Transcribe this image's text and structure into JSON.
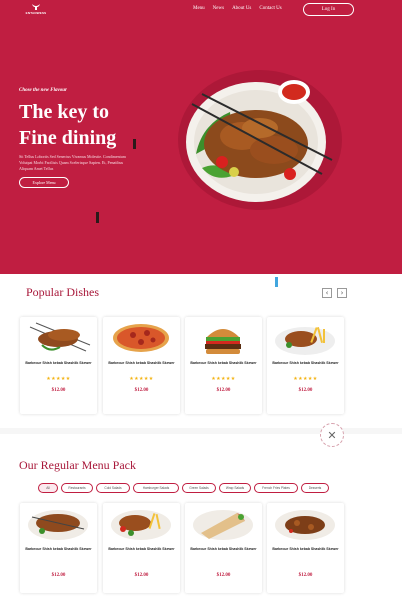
{
  "header": {
    "brand": "ENTANWESS",
    "nav": [
      "Menu",
      "News",
      "About Us",
      "Contact Us"
    ],
    "login_label": "Log In"
  },
  "hero": {
    "tagline": "Chose the new Flavour",
    "headline_line1": "The key to",
    "headline_line2": "Fine dining",
    "description": "Sit Tellus Lobortis Sed Senectus Vivamus Molestie. Condimentum Volutpat Morbi Facilisis Quam Scelerisque Sapien. Et, Penatibus Aliquam Amet Tellus",
    "explore_label": "Explore Menu"
  },
  "popular": {
    "title": "Popular Dishes",
    "prev_icon": "‹",
    "next_icon": "›",
    "cards": [
      {
        "image": "kebab-skewers",
        "title": "Barbecue Shish kebab Shashlik Skewer",
        "stars": "★★★★★",
        "price": "$12.00"
      },
      {
        "image": "pizza",
        "title": "Barbecue Shish kebab Shashlik Skewer",
        "stars": "★★★★★",
        "price": "$12.00"
      },
      {
        "image": "burger",
        "title": "Barbecue Shish kebab Shashlik Skewer",
        "stars": "★★★★★",
        "price": "$12.00"
      },
      {
        "image": "fries-platter",
        "title": "Barbecue Shish kebab Shashlik Skewer",
        "stars": "★★★★★",
        "price": "$12.00"
      }
    ]
  },
  "close_icon": "✕",
  "menu_pack": {
    "title": "Our Regular Menu Pack",
    "filters": [
      "All",
      "Restaurants",
      "Cold Salads",
      "Hamburger Salads",
      "Green Salads",
      "Wrap Salads",
      "French Fries Plates",
      "Desserts"
    ],
    "active_filter": "All",
    "cards": [
      {
        "image": "kebab-plate",
        "title": "Barbecue Shish kebab Shashlik Skewer",
        "price": "$12.00"
      },
      {
        "image": "kebab-plate-fries",
        "title": "Barbecue Shish kebab Shashlik Skewer",
        "price": "$12.00"
      },
      {
        "image": "wrap",
        "title": "Barbecue Shish kebab Shashlik Skewer",
        "price": "$12.00"
      },
      {
        "image": "meat-plate",
        "title": "Barbecue Shish kebab Shashlik Skewer",
        "price": "$12.00"
      }
    ]
  },
  "colors": {
    "brand": "#c01e41",
    "star": "#f3b312"
  }
}
